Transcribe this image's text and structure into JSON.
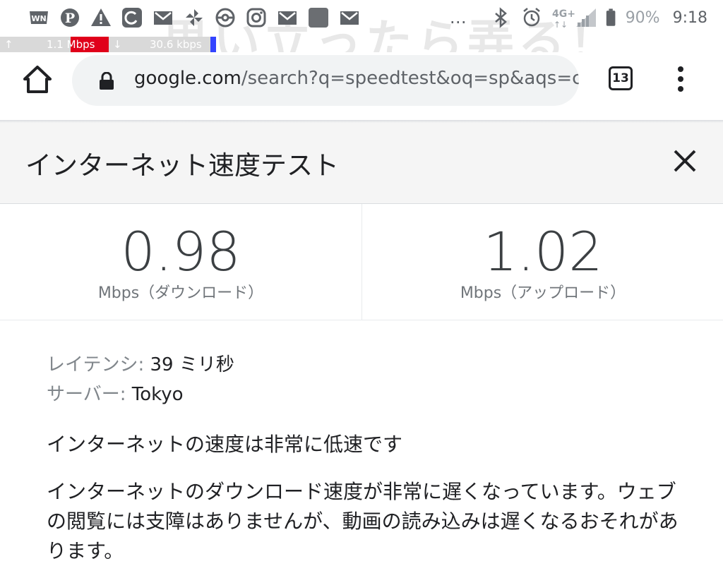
{
  "status_bar": {
    "notification_icons": [
      "news-icon",
      "pinterest-icon",
      "warning-icon",
      "browser-app-icon",
      "gmail-icon",
      "pinwheel-icon",
      "pokeball-icon",
      "instagram-icon",
      "gmail-icon",
      "blurred-app-icon",
      "gmail-icon"
    ],
    "overflow": "…",
    "network_type": "4G+",
    "battery": "90%",
    "time": "9:18"
  },
  "network_speed": {
    "up_arrow": "↑",
    "upload": "1.1 Mbps",
    "down_arrow": "↓",
    "download": "30.6 kbps"
  },
  "watermark_text": "思い立ったら弄る！",
  "toolbar": {
    "url_host": "google.com",
    "url_path": "/search?q=speedtest&oq=sp&aqs=cl",
    "tab_count": "13"
  },
  "speed_test": {
    "title": "インターネット速度テスト",
    "download_value": "0.98",
    "download_unit": "Mbps（ダウンロード）",
    "upload_value": "1.02",
    "upload_unit": "Mbps（アップロード）",
    "latency_label": "レイテンシ:",
    "latency_value": " 39 ミリ秒",
    "server_label": "サーバー:",
    "server_value": " Tokyo",
    "verdict": "インターネットの速度は非常に低速です",
    "description": "インターネットのダウンロード速度が非常に遅くなっています。ウェブの閲覧には支障はありませんが、動画の読み込みは遅くなるおそれがあります。"
  }
}
